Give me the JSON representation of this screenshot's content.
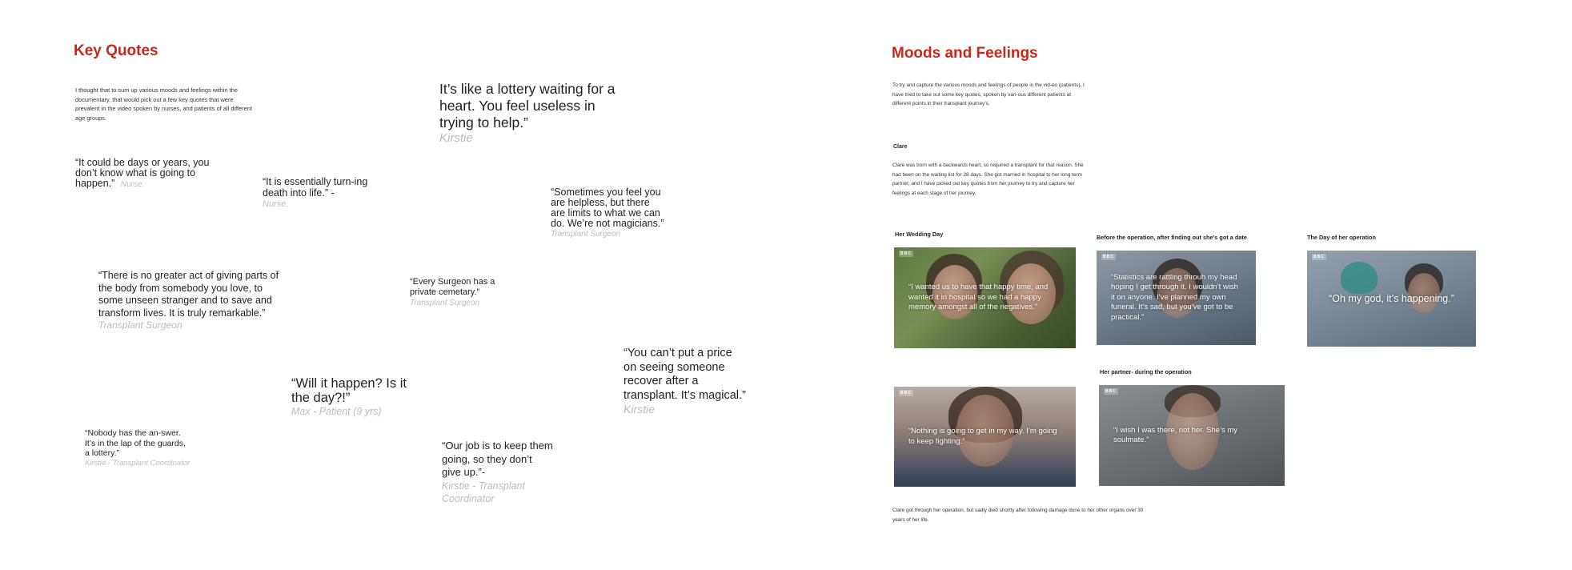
{
  "left": {
    "title": "Key Quotes",
    "intro": "I thought that to sum up various moods and feelings within the documentary, that  would pick out a few key quotes that were prevalent in the video spoken by nurses, and patients of all different age groups.",
    "quotes": [
      {
        "text": "“It could be days or years, you don’t know what is going to happen.”",
        "attr": "Nurse."
      },
      {
        "text": "“It is essentially turn-ing death into life.” -",
        "attr": "Nurse."
      },
      {
        "text": "It’s like a lottery waiting for a heart. You feel useless in trying to help.”",
        "attr": "Kirstie"
      },
      {
        "text": "“Sometimes you feel you are helpless, but there are limits to what we can do. We’re not magicians.”",
        "attr": "Transplant Surgeon"
      },
      {
        "text": "“There is no greater act of giving parts of the body from somebody you love, to some unseen stranger and to save and transform lives. It is truly remarkable.”",
        "attr": "Transplant Surgeon"
      },
      {
        "text": "“Every Surgeon has a private cemetary.”",
        "attr": "Transplant Surgeon"
      },
      {
        "text": "“Will it happen? Is it the day?!”",
        "attr": "Max - Patient (9 yrs)"
      },
      {
        "text": "“You can’t put a price on seeing someone recover after a transplant. It’s magical.”",
        "attr": "Kirstie"
      },
      {
        "text": "“Nobody has the an-swer. It’s in the lap of the guards, a lottery.”",
        "attr": "Kirstie - Transplant Coordinator"
      },
      {
        "text": "“Our job is to keep them going, so they don’t give up.”-",
        "attr": "Kirstie - Transplant Coordinator"
      }
    ]
  },
  "right": {
    "title": "Moods and Feelings",
    "intro": "To try and capture the various moods and feelings of people in the vid-eo (patients), I have tried to take out some key quotes,  spoken by vari-ous different patients at different points in their transplant journey’s.",
    "person": "Clare",
    "bio": "Clare was born with a backwards heart, so required a transplant for that reason. She had been on the waiting list  for 28 days. She got married in hospital to her long term partner, and I have picked out key quotes from her journey to try and capture her feelings at each stage of her journey.",
    "stills": [
      {
        "caption": "Her Wedding Day",
        "quote": "“I wanted us to have that happy time, and wanted it in hospital so we had a happy memory amongst all of the negatives.”"
      },
      {
        "caption": "Before the operation, after finding out she’s got a date",
        "quote": "“Statistics are rattling throuh my head hoping I get through it. I wouldn’t wish it on anyone. I’ve planned my own funeral. It’s sad, but you’ve got to be practical.”"
      },
      {
        "caption": "The Day of her operation",
        "quote": "“Oh my god, it’s happening.”"
      },
      {
        "caption": "",
        "quote": "“Nothing is going to get in my way. I’m going to keep fighting.”"
      },
      {
        "caption": "Her partner- during the operation",
        "quote": "“I wish I was there, not her. She’s my soulmate.”"
      }
    ],
    "bbc_mark": "BBC",
    "closing": "Clare got through her operation, but sadly died shortly after following damage done to her other organs over 30 years of her life."
  }
}
